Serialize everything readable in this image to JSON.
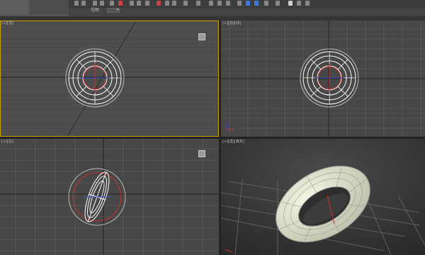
{
  "toolbar": {
    "reference_label": "视图",
    "reference_value": "▾"
  },
  "viewports": {
    "top_left": {
      "label": "[+][顶]"
    },
    "top_right": {
      "label": "[+][前][线]"
    },
    "bottom_left": {
      "label": "[+][左]"
    },
    "bottom_right": {
      "label": "[+][透][真实]"
    }
  },
  "colors": {
    "viewport_bg": "#4a4a4a",
    "grid_line": "#5a5a5a",
    "active_border": "#c8a000",
    "torus_wire": "#ffffff",
    "gizmo_red": "#d03030",
    "gizmo_blue": "#3050d0",
    "torus_shaded": "#e8ecd0"
  }
}
